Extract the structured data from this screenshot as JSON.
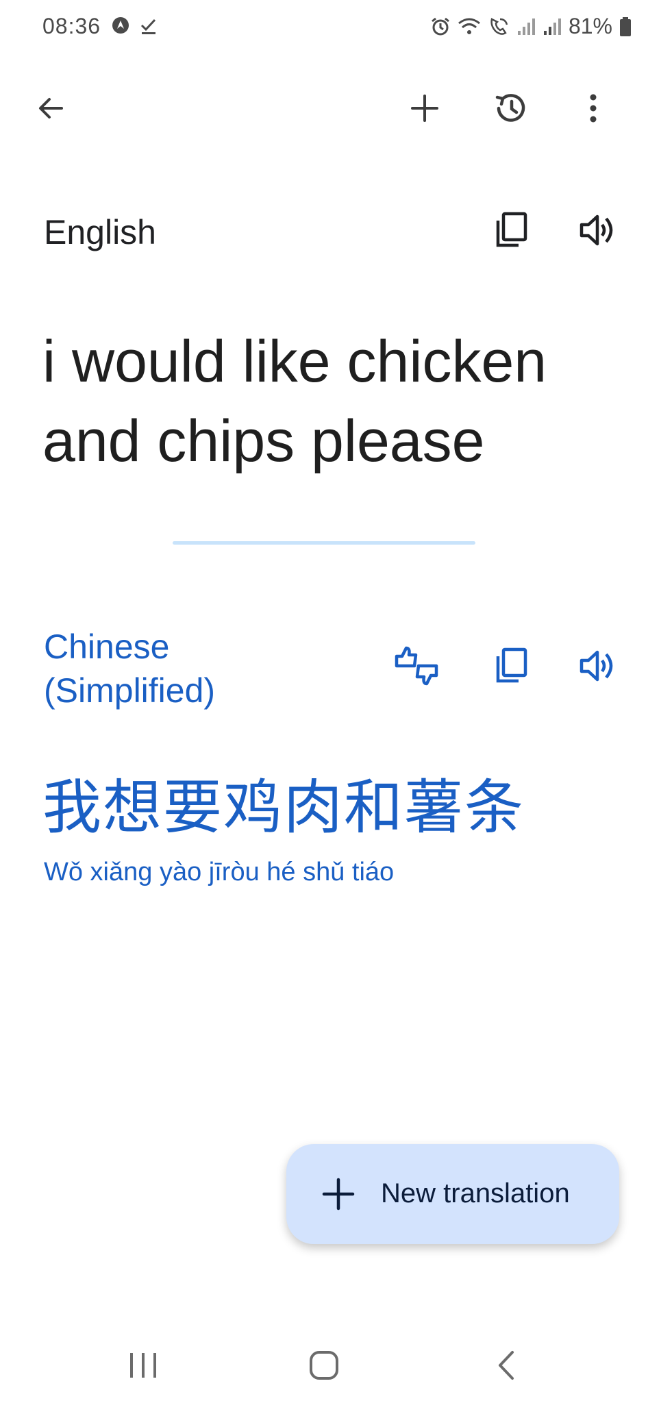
{
  "status_bar": {
    "time": "08:36",
    "battery": "81%",
    "icons": [
      "navigation-icon",
      "check-icon",
      "alarm-icon",
      "wifi-icon",
      "wifi-calling-icon",
      "signal-icon",
      "signal-icon",
      "battery-icon"
    ]
  },
  "app_bar": {
    "icons": [
      "back-arrow-icon",
      "plus-icon",
      "history-icon",
      "more-vert-icon"
    ]
  },
  "source": {
    "language": "English",
    "text": "i would like chicken and chips please",
    "icons": [
      "copy-icon",
      "volume-icon"
    ]
  },
  "target": {
    "language": "Chinese (Simplified)",
    "text": "我想要鸡肉和薯条",
    "romanization": "Wǒ xiǎng yào jīròu hé shǔ tiáo",
    "icons": [
      "swap-feedback-icon",
      "copy-icon",
      "volume-icon"
    ]
  },
  "fab": {
    "label": "New translation",
    "icon": "plus-icon"
  },
  "colors": {
    "accent": "#1a5fc4",
    "fab_bg": "#d3e3fd",
    "divider": "#c8e3fb",
    "text_primary": "#1f1f1f"
  },
  "nav_bar": {
    "icons": [
      "recent-apps-icon",
      "home-icon",
      "nav-back-icon"
    ]
  }
}
